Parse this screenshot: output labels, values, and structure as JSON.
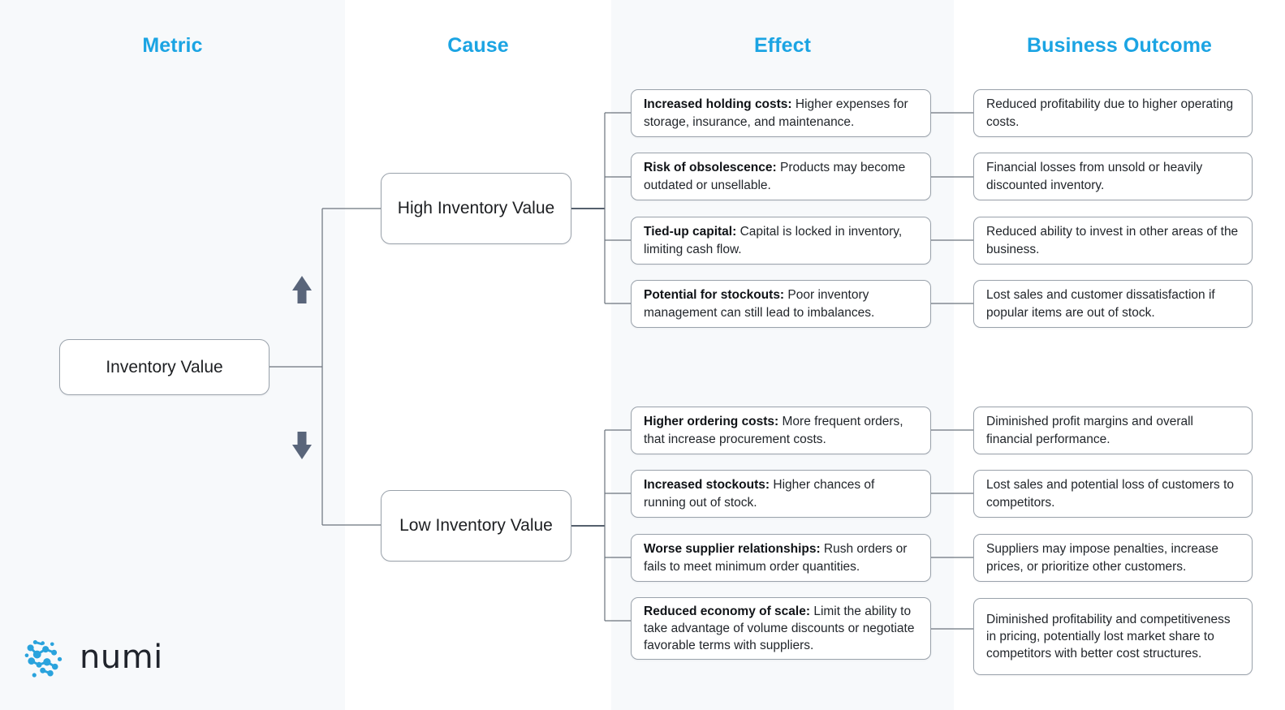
{
  "columns": [
    {
      "id": "metric",
      "title": "Metric"
    },
    {
      "id": "cause",
      "title": "Cause"
    },
    {
      "id": "effect",
      "title": "Effect"
    },
    {
      "id": "outcome",
      "title": "Business Outcome"
    }
  ],
  "accent_color": "#1ba4e3",
  "arrow_color": "#59657a",
  "box_border_color": "#9aa2ab",
  "metric": {
    "label": "Inventory Value"
  },
  "causes": [
    {
      "id": "high",
      "label": "High Inventory Value",
      "direction_icon": "arrow-up"
    },
    {
      "id": "low",
      "label": "Low Inventory Value",
      "direction_icon": "arrow-down"
    }
  ],
  "effects": [
    {
      "lead": "Increased holding costs:",
      "text": " Higher expenses for storage, insurance, and maintenance.",
      "outcome": "Reduced profitability due to higher operating costs."
    },
    {
      "lead": "Risk of obsolescence:",
      "text": " Products may become outdated or unsellable.",
      "outcome": "Financial losses from unsold or heavily discounted inventory."
    },
    {
      "lead": "Tied-up capital:",
      "text": " Capital is locked in inventory, limiting cash flow.",
      "outcome": "Reduced ability to invest in other areas of the business."
    },
    {
      "lead": "Potential for stockouts:",
      "text": " Poor inventory management can still lead to imbalances.",
      "outcome": "Lost sales and customer dissatisfaction if popular items are out of stock."
    },
    {
      "lead": "Higher ordering costs:",
      "text": " More frequent orders, that increase procurement costs.",
      "outcome": "Diminished profit margins and overall financial performance."
    },
    {
      "lead": "Increased stockouts:",
      "text": " Higher chances of running out of stock.",
      "outcome": "Lost sales and potential loss of customers to competitors."
    },
    {
      "lead": "Worse supplier relationships:",
      "text": " Rush orders or fails to meet minimum order quantities.",
      "outcome": "Suppliers may impose penalties, increase prices, or prioritize other customers."
    },
    {
      "lead": "Reduced economy of scale:",
      "text": " Limit the ability to take advantage of volume discounts or negotiate favorable terms with suppliers.",
      "outcome": "Diminished profitability and competitiveness in pricing, potentially lost market share to competitors with better cost structures."
    }
  ],
  "brand": {
    "word": "numi",
    "mark_icon": "numi-network-logo-icon"
  }
}
